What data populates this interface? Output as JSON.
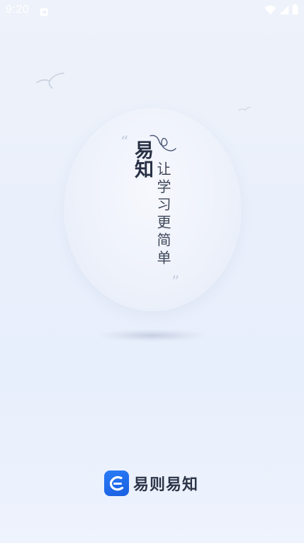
{
  "status_bar": {
    "time": "9:20",
    "icons": [
      "notification-icon",
      "wifi-icon",
      "cellular-signal-icon",
      "battery-icon"
    ]
  },
  "splash": {
    "brand_name": "易知",
    "slogan": "让学习更简单",
    "quote_open": "“",
    "quote_close": "”"
  },
  "footer": {
    "logo_icon": "app-logo-icon",
    "app_name": "易则易知"
  },
  "colors": {
    "background": "#eaf0fb",
    "logo_blue": "#1a6ef0",
    "text_dark": "#283145"
  }
}
